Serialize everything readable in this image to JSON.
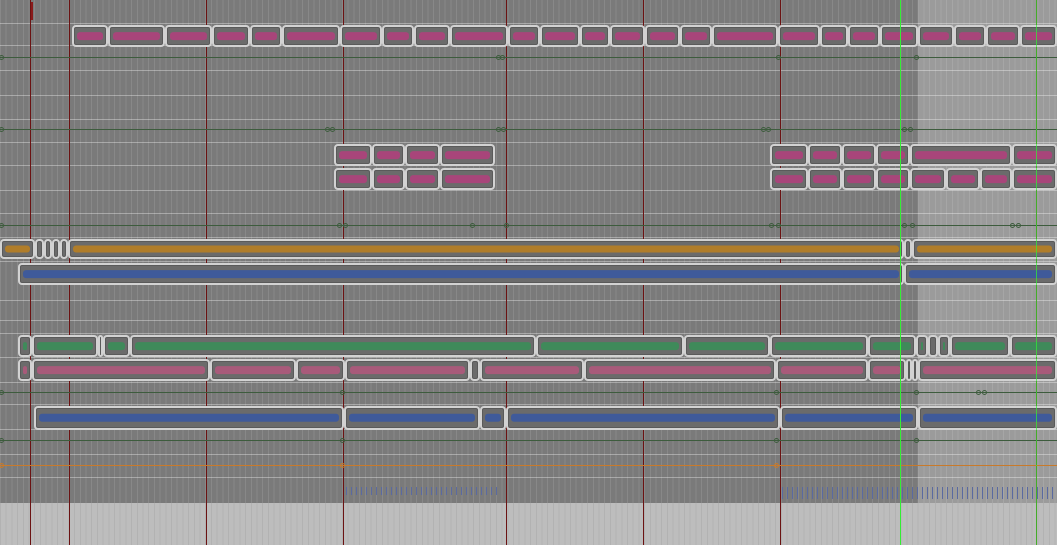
{
  "colors": {
    "background": "#7a7a7a",
    "loop_region": "#a8a8a8",
    "bottom_strip": "#bdbdbd",
    "bar_line": "#6b1212",
    "playhead": "#33ee33",
    "envelope": "#3d5c3d",
    "clip_border": "#d2d2d2",
    "clip_body": "#6b6b6b",
    "wave_magenta": "#a8457a",
    "wave_orange": "#b07d2a",
    "wave_blue": "#3f5a9a",
    "wave_green": "#3f8a5a",
    "wave_pink": "#a85a7a",
    "automation_orange": "#c97a2a",
    "midi_ticks": "#5a6aa0"
  },
  "tracks": [
    {
      "id": "track-1",
      "kind": "audio",
      "color": "#a8457a"
    },
    {
      "id": "track-2",
      "kind": "automation",
      "color": "#3d5c3d"
    },
    {
      "id": "track-3",
      "kind": "automation",
      "color": "#3d5c3d"
    },
    {
      "id": "track-4",
      "kind": "audio",
      "color": "#a8457a"
    },
    {
      "id": "track-5",
      "kind": "audio",
      "color": "#a8457a"
    },
    {
      "id": "track-6",
      "kind": "automation",
      "color": "#3d5c3d"
    },
    {
      "id": "track-7",
      "kind": "audio",
      "color": "#b07d2a"
    },
    {
      "id": "track-8",
      "kind": "audio",
      "color": "#3f5a9a"
    },
    {
      "id": "track-9",
      "kind": "audio",
      "color": "#3f8a5a"
    },
    {
      "id": "track-10",
      "kind": "audio",
      "color": "#a85a7a"
    },
    {
      "id": "track-11",
      "kind": "automation",
      "color": "#3d5c3d"
    },
    {
      "id": "track-12",
      "kind": "audio",
      "color": "#3f5a9a"
    },
    {
      "id": "track-13",
      "kind": "automation",
      "color": "#3d5c3d"
    },
    {
      "id": "track-14",
      "kind": "automation",
      "color": "#c97a2a"
    },
    {
      "id": "track-15",
      "kind": "midi",
      "color": "#5a6aa0"
    }
  ]
}
